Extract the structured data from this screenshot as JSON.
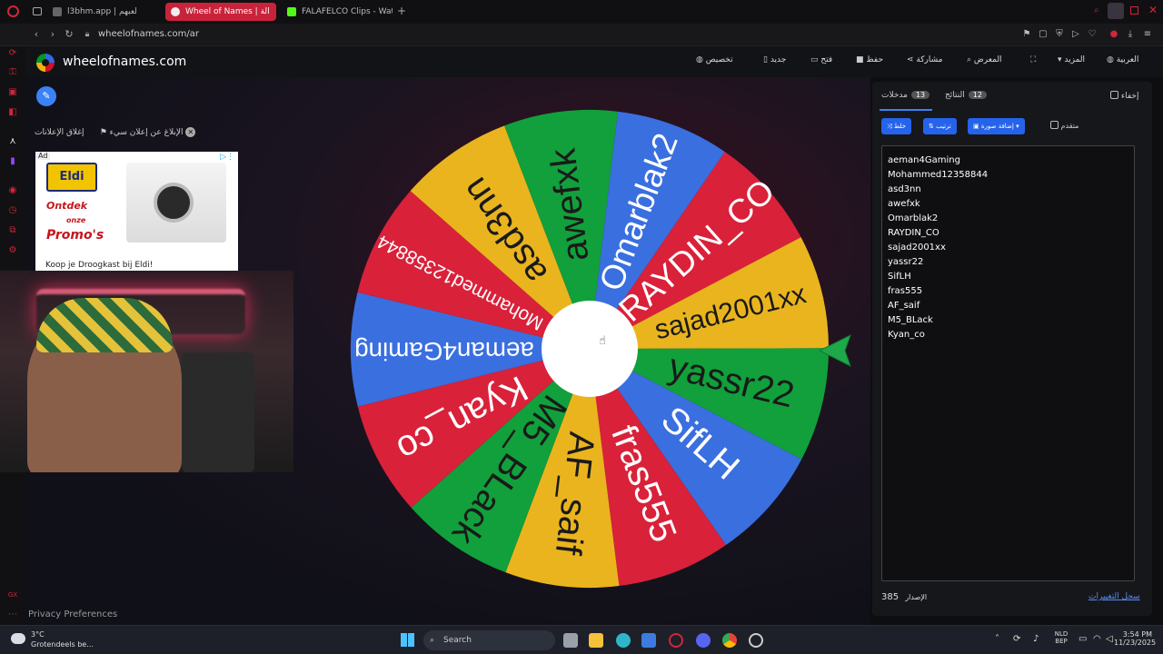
{
  "browser": {
    "tabs": [
      {
        "title": "l3bhm.app | لعبهم"
      },
      {
        "title": "Wheel of Names | الة"
      },
      {
        "title": "FALAFELCO Clips - Watch"
      }
    ],
    "url": "wheelofnames.com/ar"
  },
  "site": {
    "name": "wheelofnames.com",
    "menu": {
      "language": "العربية",
      "more": "المزيد",
      "gallery": "المعرض",
      "share": "مشاركة",
      "save": "حفظ",
      "open": "فتح",
      "new": "جديد",
      "customize": "تخصيص"
    }
  },
  "ads": {
    "close_ads": "إغلاق الإعلانات",
    "report_ad": "الإبلاغ عن إعلان سيء",
    "ad_tag": "Ad",
    "brand": "Eldi",
    "promo_line1": "Ontdek",
    "promo_line2": "onze",
    "promo_line3": "Promo's",
    "caption": "Koop je Droogkast bij Eldi!"
  },
  "footer": {
    "privacy": "Privacy Preferences"
  },
  "colors": {
    "red": "#d9213a",
    "blue": "#3a6fe0",
    "yellow": "#eab41e",
    "green": "#11a03b",
    "accent": "#2563eb"
  },
  "wheel": {
    "segments": [
      {
        "name": "aeman4Gaming",
        "color": "blue"
      },
      {
        "name": "Mohammed12358844",
        "color": "red"
      },
      {
        "name": "asd3nn",
        "color": "yellow"
      },
      {
        "name": "awefxk",
        "color": "green"
      },
      {
        "name": "Omarblak2",
        "color": "blue"
      },
      {
        "name": "RAYDIN_CO",
        "color": "red"
      },
      {
        "name": "sajad2001xx",
        "color": "yellow"
      },
      {
        "name": "yassr22",
        "color": "green"
      },
      {
        "name": "SifLH",
        "color": "blue"
      },
      {
        "name": "fras555",
        "color": "red"
      },
      {
        "name": "AF_saif",
        "color": "yellow"
      },
      {
        "name": "M5_BLack",
        "color": "green"
      },
      {
        "name": "Kyan_co",
        "color": "red"
      }
    ]
  },
  "panel": {
    "tab_entries": "مدخلات",
    "entries_count": "13",
    "tab_results": "النتائج",
    "results_count": "12",
    "hide": "إخفاء",
    "shuffle": "خلط",
    "sort": "ترتيب",
    "add_image": "إضافة صورة",
    "advanced": "متقدم",
    "entries": [
      "aeman4Gaming",
      "Mohammed12358844",
      "asd3nn",
      "awefxk",
      "Omarblak2",
      "RAYDIN_CO",
      "sajad2001xx",
      "yassr22",
      "SifLH",
      "fras555",
      "AF_saif",
      "M5_BLack",
      "Kyan_co"
    ],
    "version_label": "الإصدار",
    "version": "385",
    "changelog": "سجل التغييرات"
  },
  "taskbar": {
    "temperature": "3°C",
    "weather": "Grotendeels be...",
    "search": "Search",
    "lang1": "NLD",
    "lang2": "BEP",
    "time": "3:54 PM",
    "date": "11/23/2025"
  }
}
